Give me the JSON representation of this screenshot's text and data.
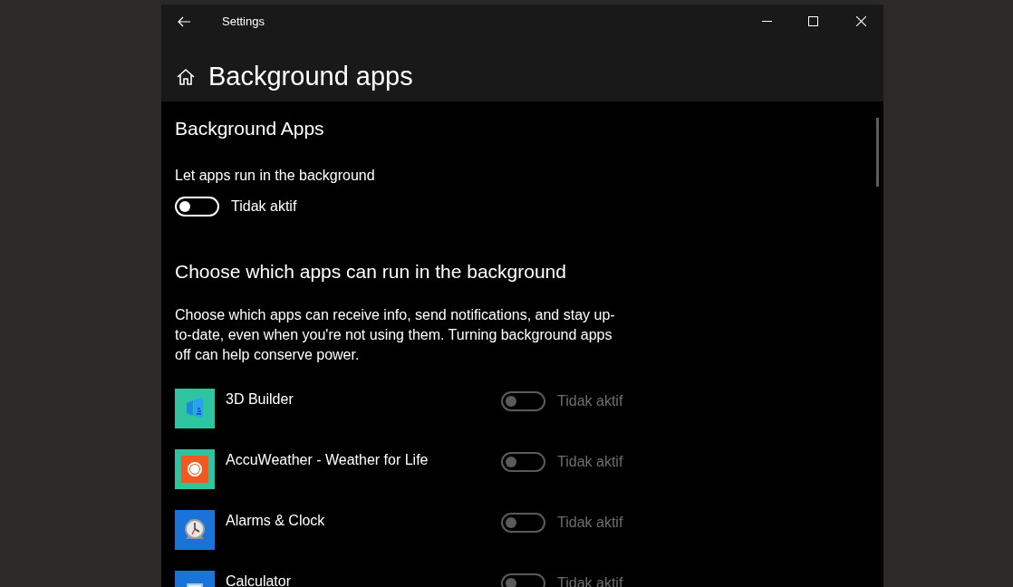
{
  "window": {
    "title": "Settings"
  },
  "page": {
    "title": "Background apps"
  },
  "section": {
    "title": "Background Apps",
    "setting_label": "Let apps run in the background",
    "toggle": {
      "on": false,
      "disabled": false,
      "label": "Tidak aktif"
    }
  },
  "apps_section": {
    "title": "Choose which apps can run in the background",
    "description": "Choose which apps can receive info, send notifications, and stay up-to-date, even when you're not using them. Turning background apps off can help conserve power.",
    "apps": [
      {
        "name": "3D Builder",
        "kind": "builder",
        "color": "#2ec4a0",
        "on": false,
        "disabled": true,
        "label": "Tidak aktif"
      },
      {
        "name": "AccuWeather - Weather for Life",
        "kind": "weather",
        "color": "#2ec4a0",
        "on": false,
        "disabled": true,
        "label": "Tidak aktif"
      },
      {
        "name": "Alarms & Clock",
        "kind": "clock",
        "color": "#1a73d9",
        "on": false,
        "disabled": true,
        "label": "Tidak aktif"
      },
      {
        "name": "Calculator",
        "kind": "calculator",
        "color": "#1a73d9",
        "on": false,
        "disabled": true,
        "label": "Tidak aktif"
      }
    ]
  }
}
